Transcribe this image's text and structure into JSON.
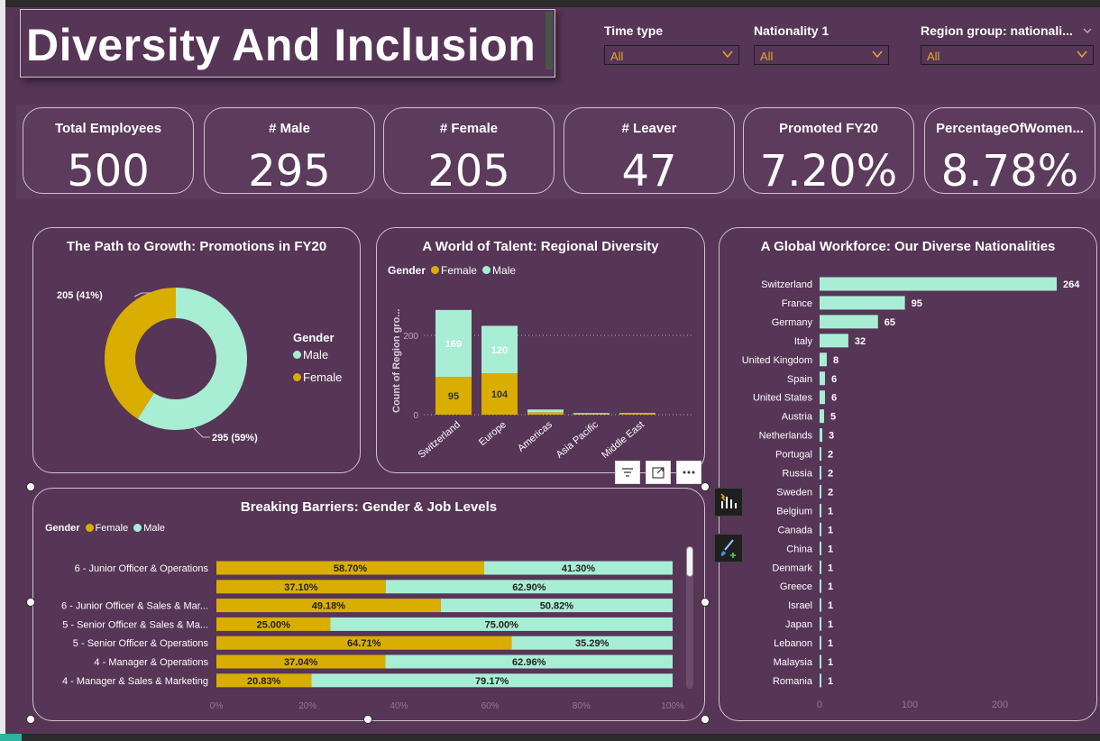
{
  "title": "Diversity And Inclusion",
  "slicers": [
    {
      "label": "Time type",
      "value": "All"
    },
    {
      "label": "Nationality 1",
      "value": "All"
    },
    {
      "label": "Region group: nationali...",
      "value": "All"
    }
  ],
  "kpis": [
    {
      "label": "Total Employees",
      "value": "500"
    },
    {
      "label": "# Male",
      "value": "295"
    },
    {
      "label": "# Female",
      "value": "205"
    },
    {
      "label": "# Leaver",
      "value": "47"
    },
    {
      "label": "Promoted FY20",
      "value": "7.20%"
    },
    {
      "label": "PercentageOfWomen...",
      "value": "8.78%"
    }
  ],
  "colors": {
    "female": "#d9ae00",
    "male": "#a8eed4",
    "background": "#563556"
  },
  "donut_card": {
    "title": "The Path to Growth: Promotions in FY20",
    "legend_title": "Gender",
    "legend_items": [
      "Male",
      "Female"
    ]
  },
  "region_card": {
    "title": "A World of Talent: Regional Diversity",
    "legend_title": "Gender",
    "legend_items": [
      "Female",
      "Male"
    ]
  },
  "nationality_card": {
    "title": "A Global Workforce: Our Diverse Nationalities"
  },
  "levels_card": {
    "title": "Breaking Barriers: Gender & Job Levels",
    "legend_title": "Gender",
    "legend_items": [
      "Female",
      "Male"
    ]
  },
  "chart_data": [
    {
      "type": "pie",
      "variant": "donut",
      "title": "The Path to Growth: Promotions in FY20",
      "slices": [
        {
          "name": "Male",
          "value": 295,
          "label": "295 (59%)"
        },
        {
          "name": "Female",
          "value": 205,
          "label": "205 (41%)"
        }
      ],
      "legend": "right"
    },
    {
      "type": "bar",
      "stacked": true,
      "title": "A World of Talent: Regional Diversity",
      "ylabel": "Count of Region gro...",
      "categories": [
        "Switzerland",
        "Europe",
        "Americas",
        "Asia Pacific",
        "Middle East"
      ],
      "series": [
        {
          "name": "Female",
          "values": [
            95,
            104,
            6,
            1,
            2
          ]
        },
        {
          "name": "Male",
          "values": [
            169,
            120,
            7,
            3,
            2
          ]
        }
      ],
      "y_ticks": [
        "0",
        "200"
      ],
      "ylim": [
        0,
        300
      ],
      "legend": "top-left"
    },
    {
      "type": "bar",
      "orientation": "horizontal",
      "title": "A Global Workforce: Our Diverse Nationalities",
      "categories": [
        "Switzerland",
        "France",
        "Germany",
        "Italy",
        "United Kingdom",
        "Spain",
        "United States",
        "Austria",
        "Netherlands",
        "Portugal",
        "Russia",
        "Sweden",
        "Belgium",
        "Canada",
        "China",
        "Denmark",
        "Greece",
        "Israel",
        "Japan",
        "Lebanon",
        "Malaysia",
        "Romania"
      ],
      "values": [
        264,
        95,
        65,
        32,
        8,
        6,
        6,
        5,
        3,
        2,
        2,
        2,
        1,
        1,
        1,
        1,
        1,
        1,
        1,
        1,
        1,
        1
      ],
      "x_ticks": [
        "0",
        "100",
        "200"
      ],
      "xlim": [
        0,
        260
      ]
    },
    {
      "type": "bar",
      "orientation": "horizontal",
      "stacked": true,
      "percent": true,
      "title": "Breaking Barriers: Gender & Job Levels",
      "categories": [
        "6 - Junior Officer & Operations",
        "",
        "6 - Junior Officer & Sales & Mar...",
        "5 - Senior Officer & Sales & Ma...",
        "5 - Senior Officer & Operations",
        "4 - Manager & Operations",
        "4 - Manager & Sales & Marketing"
      ],
      "series": [
        {
          "name": "Female",
          "values": [
            58.7,
            37.1,
            49.18,
            25.0,
            64.71,
            37.04,
            20.83
          ],
          "labels": [
            "58.70%",
            "37.10%",
            "49.18%",
            "25.00%",
            "64.71%",
            "37.04%",
            "20.83%"
          ]
        },
        {
          "name": "Male",
          "values": [
            41.3,
            62.9,
            50.82,
            75.0,
            35.29,
            62.96,
            79.17
          ],
          "labels": [
            "41.30%",
            "62.90%",
            "50.82%",
            "75.00%",
            "35.29%",
            "62.96%",
            "79.17%"
          ]
        }
      ],
      "x_ticks": [
        "0%",
        "20%",
        "40%",
        "60%",
        "80%",
        "100%"
      ],
      "legend": "top-left"
    }
  ]
}
